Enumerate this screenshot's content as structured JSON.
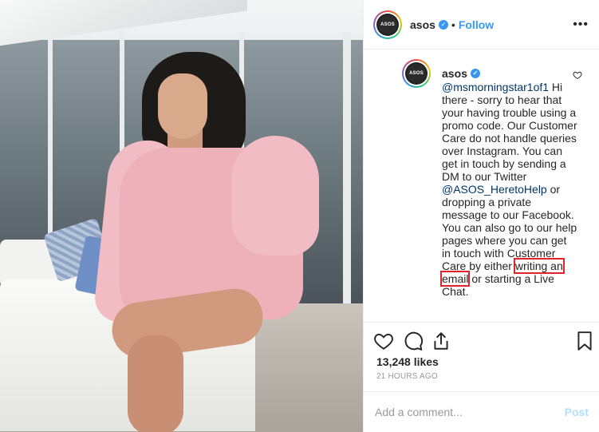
{
  "header": {
    "username": "asos",
    "separator": "•",
    "follow_label": "Follow",
    "avatar_text": "ASOS"
  },
  "comment": {
    "username": "asos",
    "mention": "@msmorningstar1of1",
    "text_part1": " Hi there - sorry to hear that your having trouble using a promo code. Our Customer Care do not handle queries over Instagram. You can get in touch by sending a DM to our Twitter ",
    "twitter_handle": "@ASOS_HeretoHelp",
    "text_part2": " or dropping a private message to our Facebook. You can also go to our help pages where you can get in touch with Customer Care by either ",
    "highlighted": "writing an email",
    "text_part3": " or starting a Live Chat."
  },
  "stats": {
    "likes": "13,248 likes",
    "time": "21 HOURS AGO"
  },
  "composer": {
    "placeholder": "Add a comment...",
    "post_label": "Post"
  },
  "icons": {
    "like": "heart-icon",
    "comment": "comment-icon",
    "share": "share-icon",
    "save": "bookmark-icon",
    "verified": "verified-badge-icon",
    "more": "more-options-icon"
  },
  "colors": {
    "accent": "#3897f0",
    "highlight_box": "#e0242b",
    "link": "#003569"
  }
}
